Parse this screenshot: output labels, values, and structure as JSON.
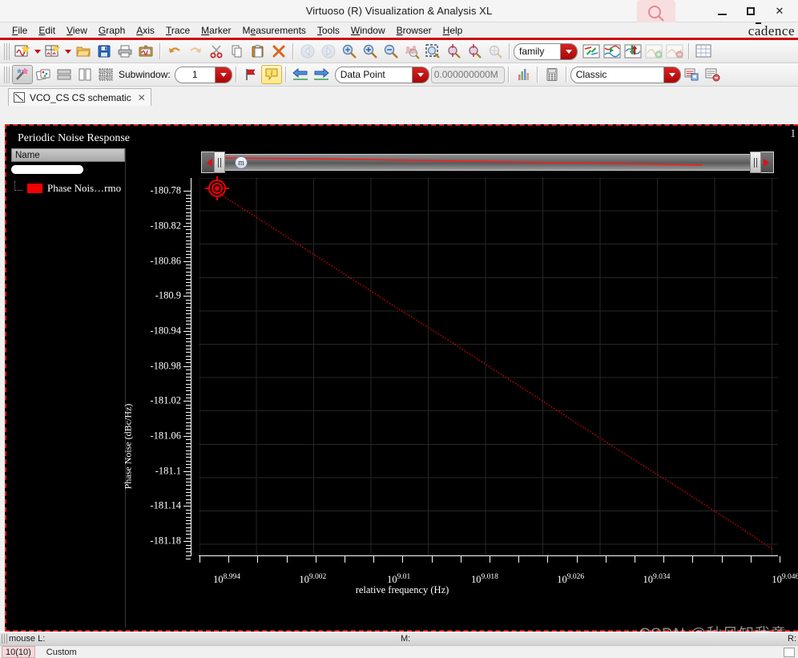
{
  "window": {
    "title": "Virtuoso (R) Visualization & Analysis XL",
    "minimize_label": "−",
    "maximize_label": "□",
    "close_label": "✕",
    "search_icon": "search-icon",
    "brand": "cadence"
  },
  "menu": {
    "items": [
      {
        "label": "File",
        "mnemonic": "F"
      },
      {
        "label": "Edit",
        "mnemonic": "E"
      },
      {
        "label": "View",
        "mnemonic": "V"
      },
      {
        "label": "Graph",
        "mnemonic": "G"
      },
      {
        "label": "Axis",
        "mnemonic": "A"
      },
      {
        "label": "Trace",
        "mnemonic": "T"
      },
      {
        "label": "Marker",
        "mnemonic": "M"
      },
      {
        "label": "Measurements",
        "mnemonic": "M"
      },
      {
        "label": "Tools",
        "mnemonic": "T"
      },
      {
        "label": "Window",
        "mnemonic": "W"
      },
      {
        "label": "Browser",
        "mnemonic": "B"
      },
      {
        "label": "Help",
        "mnemonic": "H"
      }
    ]
  },
  "toolbar_row1": {
    "buttons": [
      {
        "name": "new-graph-window-icon",
        "glyph": "wave-new"
      },
      {
        "name": "new-subwindow-icon",
        "glyph": "grid-new"
      },
      {
        "name": "open-icon",
        "glyph": "folder"
      },
      {
        "name": "save-icon",
        "glyph": "floppy"
      },
      {
        "name": "print-icon",
        "glyph": "printer"
      },
      {
        "name": "plot-image-icon",
        "glyph": "frame-wave"
      },
      {
        "name": "undo-icon",
        "glyph": "undo"
      },
      {
        "name": "redo-icon",
        "glyph": "redo"
      },
      {
        "name": "cut-icon",
        "glyph": "scissors"
      },
      {
        "name": "copy-icon",
        "glyph": "copy"
      },
      {
        "name": "paste-icon",
        "glyph": "paste"
      },
      {
        "name": "delete-icon",
        "glyph": "x-delete"
      },
      {
        "name": "back-icon",
        "glyph": "arrow-left-circle"
      },
      {
        "name": "forward-icon",
        "glyph": "arrow-right-circle"
      },
      {
        "name": "zoom-fit-icon",
        "glyph": "zoom-fit"
      },
      {
        "name": "zoom-in-icon",
        "glyph": "zoom-in"
      },
      {
        "name": "zoom-out-icon",
        "glyph": "zoom-out"
      },
      {
        "name": "zoom-vertical-icon",
        "glyph": "zoom-vert"
      },
      {
        "name": "zoom-area-icon",
        "glyph": "zoom-area"
      },
      {
        "name": "zoom-x-icon",
        "glyph": "zoom-x"
      },
      {
        "name": "zoom-y-icon",
        "glyph": "zoom-y"
      },
      {
        "name": "zoom-point-icon",
        "glyph": "zoom-point"
      }
    ],
    "family_select": {
      "value": "family",
      "name": "family-select"
    },
    "trace_buttons": [
      {
        "name": "swap-traces-icon",
        "glyph": "swap"
      },
      {
        "name": "split-traces-icon",
        "glyph": "split"
      },
      {
        "name": "merge-traces-icon",
        "glyph": "merge"
      },
      {
        "name": "add-trace-icon",
        "glyph": "add-trace"
      },
      {
        "name": "remove-trace-icon",
        "glyph": "remove-trace"
      }
    ],
    "grid_button": {
      "name": "grid-toggle-icon"
    }
  },
  "toolbar_row2": {
    "buttons": [
      {
        "name": "wand-icon",
        "glyph": "wand"
      },
      {
        "name": "cards-icon",
        "glyph": "cards"
      },
      {
        "name": "stack-horizontal-icon",
        "glyph": "rows"
      },
      {
        "name": "stack-vertical-icon",
        "glyph": "cols"
      },
      {
        "name": "tile-icon",
        "glyph": "tile"
      }
    ],
    "subwindow_label": "Subwindow:",
    "subwindow_value": "1",
    "flag_button": {
      "name": "flag-icon"
    },
    "info_button": {
      "name": "info-icon"
    },
    "prev_marker": {
      "name": "previous-marker-icon"
    },
    "next_marker": {
      "name": "next-marker-icon"
    },
    "marker_type_select": {
      "value": "Data Point",
      "name": "marker-type-select"
    },
    "marker_value_field": {
      "value": "0.000000000M",
      "name": "marker-value-field"
    },
    "histogram_button": {
      "name": "histogram-icon"
    },
    "calculator_button": {
      "name": "calculator-icon"
    },
    "theme_select": {
      "value": "Classic",
      "name": "theme-select"
    },
    "save_view_button": {
      "name": "save-view-icon"
    },
    "delete_view_button": {
      "name": "delete-view-icon"
    }
  },
  "tabs": [
    {
      "label": "VCO_CS CS schematic",
      "close": "✕",
      "active": true
    }
  ],
  "plot": {
    "title": "Periodic Noise Response",
    "corner_label": "1",
    "tree": {
      "header": "Name",
      "items": [
        {
          "label": "Phase Nois…rmo",
          "color": "#f50000"
        }
      ]
    },
    "marker_badge": "m"
  },
  "chart_data": {
    "type": "line",
    "title": "Periodic Noise Response",
    "xlabel": "relative frequency (Hz)",
    "ylabel": "Phase Noise (dBc/Hz)",
    "xscale": "log",
    "yscale": "linear",
    "grid": true,
    "legend_position": "left-panel",
    "xtick_labels": [
      "10^8.994",
      "10^9.002",
      "10^9.01",
      "10^9.018",
      "10^9.026",
      "10^9.034",
      "10^9.046"
    ],
    "xtick_mantissa": "10",
    "xtick_exponents": [
      "8.994",
      "9.002",
      "9.01",
      "9.018",
      "9.026",
      "9.034",
      "9.046"
    ],
    "ytick_labels": [
      "-180.78",
      "-180.82",
      "-180.86",
      "-180.9",
      "-180.94",
      "-180.98",
      "-181.02",
      "-181.06",
      "-181.1",
      "-181.14",
      "-181.18"
    ],
    "ylim": [
      -181.2,
      -180.765
    ],
    "xlim": [
      8.9925,
      9.0465
    ],
    "series": [
      {
        "name": "Phase Noise (dBc/Hz) harmonic",
        "color": "#ff0000",
        "style": "dotted",
        "x": [
          8.994,
          8.9994,
          9.0048,
          9.0102,
          9.0156,
          9.021,
          9.0264,
          9.0318,
          9.0372,
          9.0426,
          9.046
        ],
        "y": [
          -180.78,
          -180.823,
          -180.866,
          -180.909,
          -180.951,
          -180.994,
          -181.037,
          -181.08,
          -181.122,
          -181.165,
          -181.193
        ]
      }
    ],
    "markers": [
      {
        "name": "m",
        "x": 8.994,
        "y": -180.78,
        "color": "#ef0000"
      }
    ]
  },
  "statusbar": {
    "mouse_label": "mouse L:",
    "middle_label": "M:",
    "right_label": "R:"
  },
  "bottombar": {
    "count": "10(10)",
    "mode": "Custom"
  },
  "watermark": "CSDN @秋风知我意",
  "colors": {
    "accent_red": "#cf0a0a",
    "trace_red": "#ff0000",
    "plot_bg": "#000000",
    "chrome": "#f0f0f0"
  }
}
